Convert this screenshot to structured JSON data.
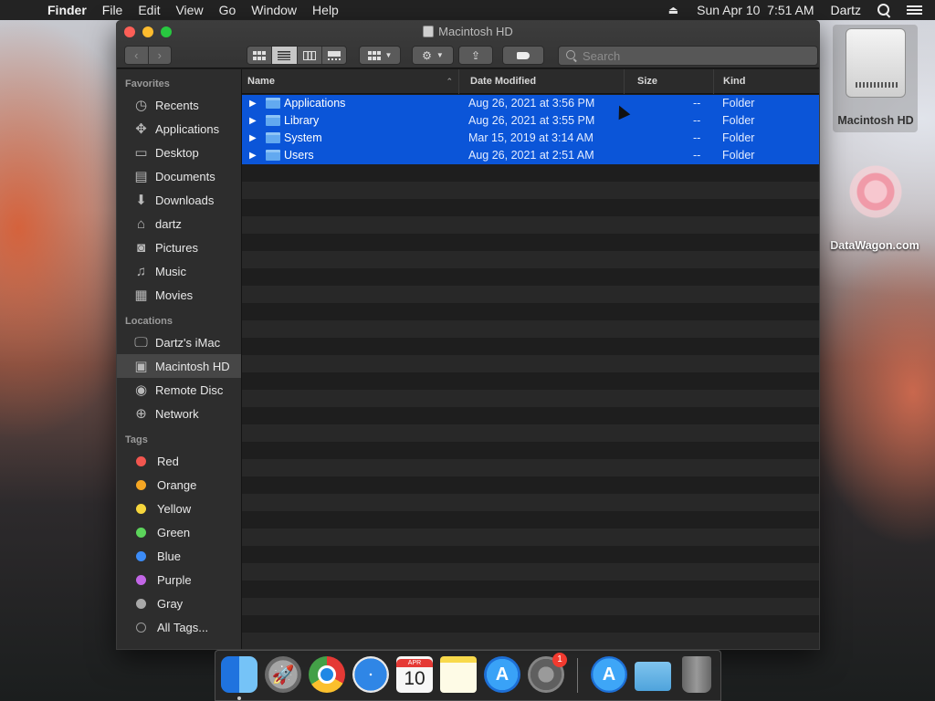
{
  "menubar": {
    "apple": "",
    "app_name": "Finder",
    "menus": [
      "File",
      "Edit",
      "View",
      "Go",
      "Window",
      "Help"
    ],
    "clock": "Sun Apr 10  7:51 AM",
    "user": "Dartz"
  },
  "window": {
    "title": "Macintosh HD",
    "search_placeholder": "Search"
  },
  "sidebar": {
    "favorites_title": "Favorites",
    "favorites": [
      {
        "label": "Recents",
        "icon": "clock-icon"
      },
      {
        "label": "Applications",
        "icon": "applications-icon"
      },
      {
        "label": "Desktop",
        "icon": "desktop-icon"
      },
      {
        "label": "Documents",
        "icon": "documents-icon"
      },
      {
        "label": "Downloads",
        "icon": "downloads-icon"
      },
      {
        "label": "dartz",
        "icon": "home-icon"
      },
      {
        "label": "Pictures",
        "icon": "camera-icon"
      },
      {
        "label": "Music",
        "icon": "music-note-icon"
      },
      {
        "label": "Movies",
        "icon": "film-icon"
      }
    ],
    "locations_title": "Locations",
    "locations": [
      {
        "label": "Dartz's iMac",
        "icon": "imac-icon"
      },
      {
        "label": "Macintosh HD",
        "icon": "hard-disk-icon",
        "selected": true
      },
      {
        "label": "Remote Disc",
        "icon": "disc-icon"
      },
      {
        "label": "Network",
        "icon": "globe-icon"
      }
    ],
    "tags_title": "Tags",
    "tags": [
      {
        "label": "Red",
        "color": "#f2564f"
      },
      {
        "label": "Orange",
        "color": "#f5a623"
      },
      {
        "label": "Yellow",
        "color": "#f6d63c"
      },
      {
        "label": "Green",
        "color": "#5cd45b"
      },
      {
        "label": "Blue",
        "color": "#3c8cf7"
      },
      {
        "label": "Purple",
        "color": "#c266e6"
      },
      {
        "label": "Gray",
        "color": "#a8a8a8"
      },
      {
        "label": "All Tags...",
        "color": ""
      }
    ]
  },
  "columns": {
    "name": "Name",
    "date": "Date Modified",
    "size": "Size",
    "kind": "Kind"
  },
  "files": [
    {
      "name": "Applications",
      "date": "Aug 26, 2021 at 3:56 PM",
      "size": "--",
      "kind": "Folder"
    },
    {
      "name": "Library",
      "date": "Aug 26, 2021 at 3:55 PM",
      "size": "--",
      "kind": "Folder"
    },
    {
      "name": "System",
      "date": "Mar 15, 2019 at 3:14 AM",
      "size": "--",
      "kind": "Folder"
    },
    {
      "name": "Users",
      "date": "Aug 26, 2021 at 2:51 AM",
      "size": "--",
      "kind": "Folder"
    }
  ],
  "desktop": {
    "hd_label": "Macintosh HD",
    "dw_label": "DataWagon.com"
  },
  "dock": {
    "calendar_month": "APR",
    "calendar_day": "10",
    "prefs_badge": "1"
  },
  "colors": {
    "selection": "#0b55d8",
    "window_bg": "#1e1e1e",
    "sidebar_bg": "#2d2d2d"
  }
}
